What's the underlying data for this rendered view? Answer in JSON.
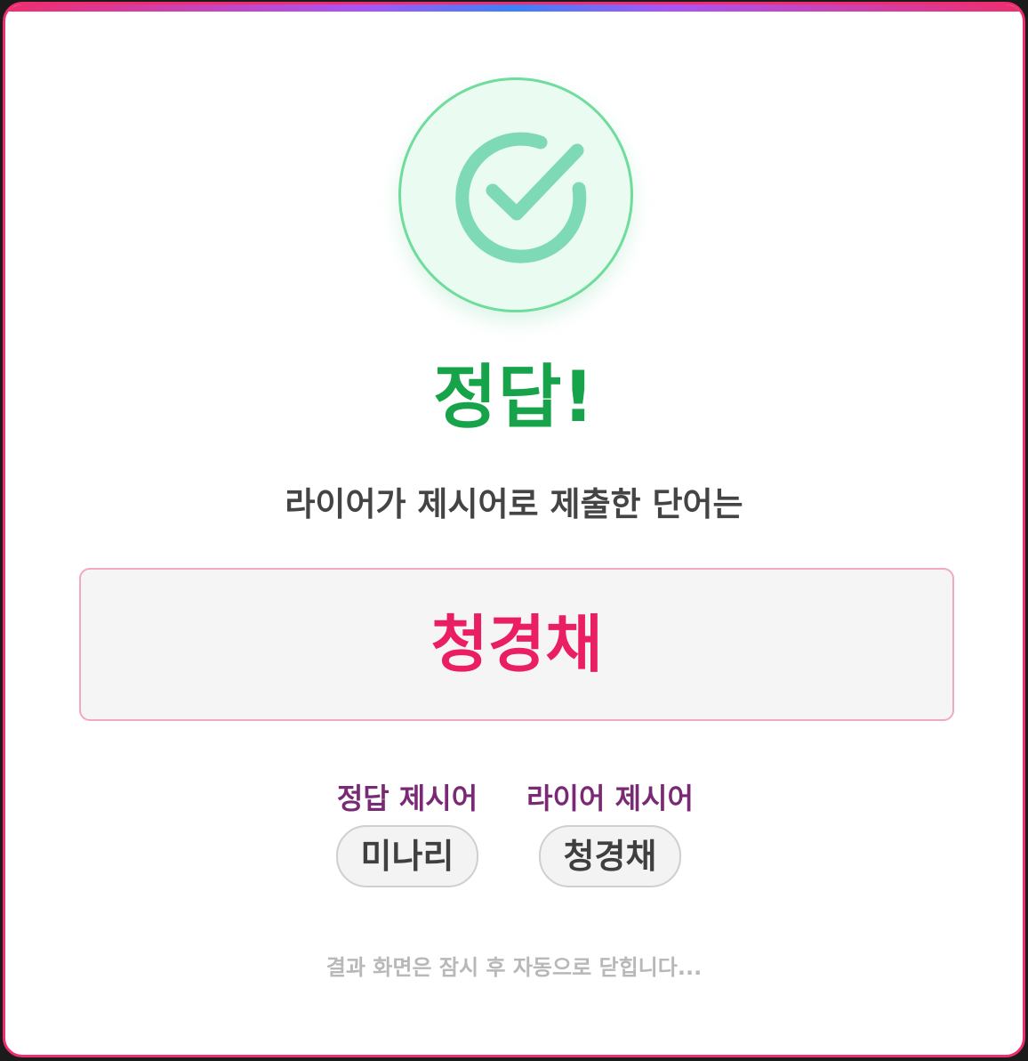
{
  "modal": {
    "icon": "check-circle-icon",
    "title": "정답!",
    "subtitle": "라이어가 제시어로 제출한 단어는",
    "submitted_word": "청경채",
    "clues": [
      {
        "label": "정답 제시어",
        "value": "미나리"
      },
      {
        "label": "라이어 제시어",
        "value": "청경채"
      }
    ],
    "footer_note": "결과 화면은 잠시 후 자동으로 닫힙니다..."
  },
  "colors": {
    "accent_border": "#ee2e6e",
    "success_green": "#16a34a",
    "word_pink": "#e91e63",
    "label_purple": "#7a2a74",
    "check_mint": "#7ed9b7"
  }
}
